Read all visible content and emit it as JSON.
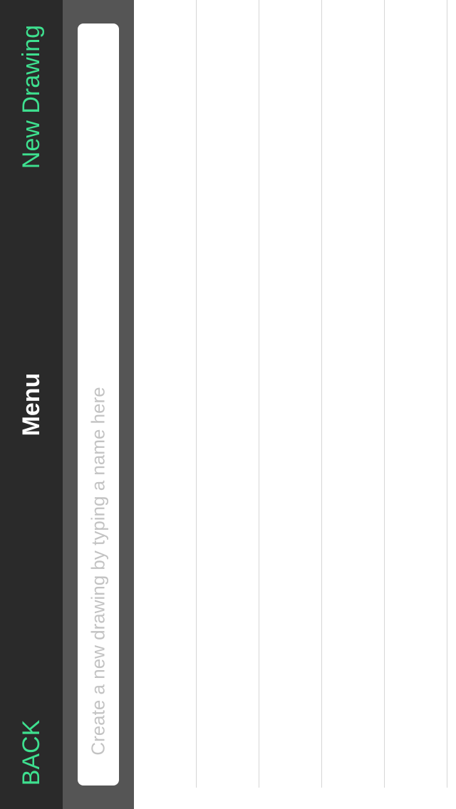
{
  "nav": {
    "back_label": "BACK",
    "title": "Menu",
    "new_drawing_label": "New Drawing"
  },
  "name_input": {
    "placeholder": "Create a new drawing by typing a name here",
    "value": ""
  },
  "drawings_list": {
    "items": []
  },
  "colors": {
    "accent": "#3ee08f",
    "nav_background": "#2a2a2a",
    "input_bar_background": "#555555",
    "placeholder_text": "#c3c3c3",
    "separator": "#d6d6d6"
  }
}
